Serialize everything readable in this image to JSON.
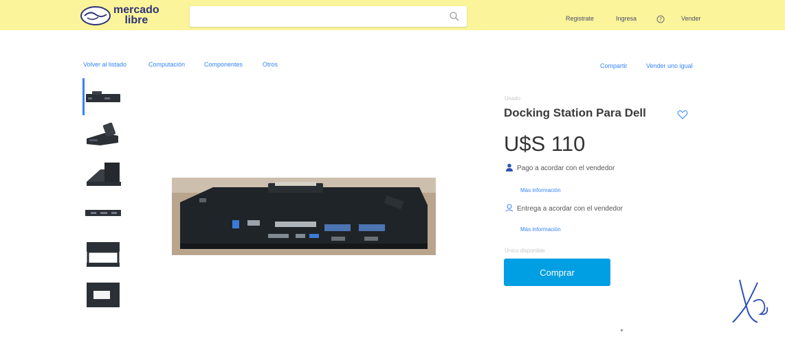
{
  "header": {
    "logo_line1": "mercado",
    "logo_line2": "libre",
    "search_placeholder": "",
    "register_label": "Registrate",
    "login_label": "Ingresa",
    "sell_label": "Vender"
  },
  "breadcrumb": {
    "back_label": "Volver al listado",
    "items": [
      "Computación",
      "Componentes",
      "Otros"
    ]
  },
  "actions": {
    "share_label": "Compartir",
    "sell_same_label": "Vender uno igual"
  },
  "product": {
    "condition": "Usado",
    "title": "Docking Station Para Dell",
    "price": "U$S 110",
    "payment_text": "Pago a acordar con el vendedor",
    "payment_more": "Más información",
    "delivery_text": "Entrega a acordar con el vendedor",
    "delivery_more": "Más información",
    "stock_text": "Único disponible",
    "buy_label": "Comprar"
  },
  "colors": {
    "header_bg": "#fbf49a",
    "accent_link": "#3483fa",
    "buy_button": "#009ee3",
    "brand_text": "#2d3277"
  },
  "icons": [
    "search-icon",
    "help-icon",
    "heart-icon",
    "user-icon",
    "pin-icon"
  ]
}
